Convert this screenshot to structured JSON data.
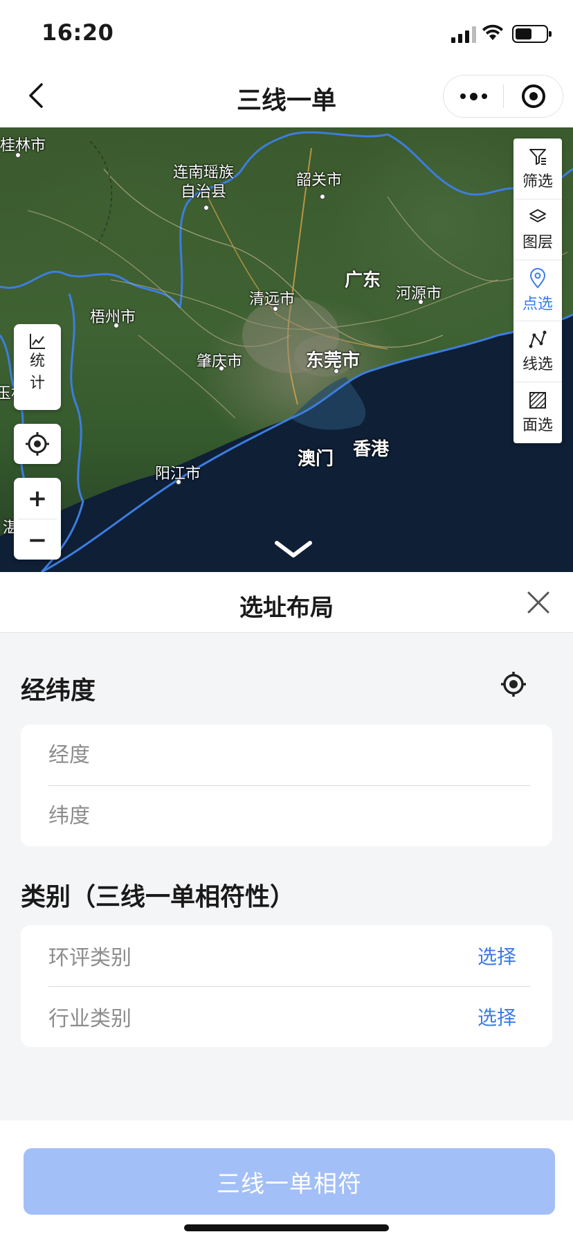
{
  "status_bar": {
    "time": "16:20",
    "battery_level": 0.55
  },
  "nav": {
    "title": "三线一单"
  },
  "map": {
    "labels": {
      "guilin": "桂林市",
      "lianshan": "连南瑶族\n自治县",
      "shaoguan": "韶关市",
      "guangdong": "广东",
      "heyuan": "河源市",
      "qingyuan": "清远市",
      "wuzhou": "梧州市",
      "zhaoqing": "肇庆市",
      "dongguan": "东莞市",
      "yulin": "玉林",
      "macau": "澳门",
      "hongkong": "香港",
      "yangjiang": "阳江市",
      "zhanjiang": "湛"
    },
    "stat_tool": {
      "line1": "统",
      "line2": "计"
    },
    "zoom_in": "+",
    "zoom_out": "−",
    "right_tools": [
      {
        "label": "筛选",
        "icon": "filter-icon"
      },
      {
        "label": "图层",
        "icon": "layers-icon"
      },
      {
        "label": "点选",
        "icon": "location-pin-icon"
      },
      {
        "label": "线选",
        "icon": "polyline-icon"
      },
      {
        "label": "面选",
        "icon": "polygon-icon"
      }
    ]
  },
  "panel": {
    "title": "选址布局",
    "coords_section": {
      "title": "经纬度",
      "longitude_placeholder": "经度",
      "latitude_placeholder": "纬度"
    },
    "category_section": {
      "title": "类别（三线一单相符性）",
      "rows": [
        {
          "label": "环评类别",
          "action": "选择"
        },
        {
          "label": "行业类别",
          "action": "选择"
        }
      ]
    },
    "submit_label": "三线一单相符"
  },
  "colors": {
    "accent": "#3b7be8",
    "submit_disabled": "#a3bff7"
  }
}
